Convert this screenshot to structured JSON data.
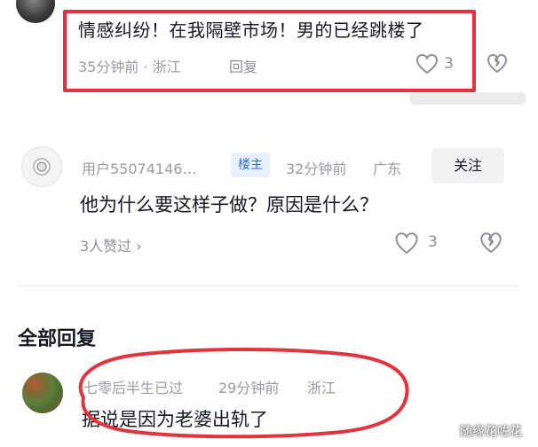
{
  "comments": [
    {
      "text": "情感纠纷！在我隔壁市场！男的已经跳楼了",
      "meta": "35分钟前 · 浙江",
      "reply_label": "回复",
      "like_count": "3",
      "icons": {
        "like": "heart-outline-icon",
        "dislike": "broken-heart-icon",
        "avatar": "avatar-icon"
      }
    },
    {
      "username": "用户55074146…",
      "badge": "楼主",
      "time": "32分钟前",
      "location": "广东",
      "follow_label": "关注",
      "text": "他为什么要这样子做？原因是什么？",
      "likers": "3人赞过 ›",
      "like_count": "3",
      "icons": {
        "like": "heart-outline-icon",
        "dislike": "broken-heart-icon",
        "avatar": "avatar-icon"
      }
    }
  ],
  "section_title": "全部回复",
  "replies": [
    {
      "username": "七零后半生已过",
      "time": "29分钟前",
      "location": "浙江",
      "text": "据说是因为老婆出轨了"
    }
  ],
  "watermark": "随缘花咗花",
  "colors": {
    "highlight_red": "#e0353f",
    "badge_blue": "#2f6fd1",
    "badge_bg": "#e8f2ff",
    "meta_gray": "#9a9ba1"
  }
}
